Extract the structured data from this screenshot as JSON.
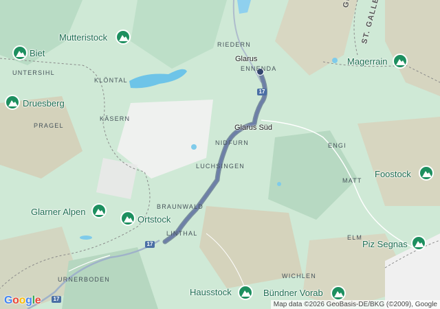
{
  "map": {
    "attribution": "Map data ©2026 GeoBasis-DE/BKG (©2009), Google",
    "logo": {
      "g": "G",
      "o1": "o",
      "o2": "o",
      "g2": "g",
      "l": "l",
      "e": "e"
    },
    "colors": {
      "land": "#cfe9d6",
      "terrain": "#b8dcc4",
      "rock": "#d9cdb8",
      "water": "#6ec4e8",
      "route": "#4b5f88",
      "road": "#9fb2c9",
      "poi": "#1d8f5f"
    }
  },
  "labels": {
    "canton_glarus": "GLARUS",
    "canton_stgallen": "ST. GALLEN",
    "riedern": "RIEDERN",
    "glarus": "Glarus",
    "ennenda": "ENNENDA",
    "untersihl": "UNTERSIHL",
    "klontal": "KLÖNTAL",
    "pragel": "PRAGEL",
    "kasern": "KÄSERN",
    "glarus_sud": "Glarus Süd",
    "nidfurn": "NIDFURN",
    "engi": "ENGI",
    "luchsingen": "LUCHSINGEN",
    "matt": "MATT",
    "braunwald": "BRAUNWALD",
    "linthal": "LINTHAL",
    "elm": "ELM",
    "urnerboden": "URNERBODEN",
    "wichlen": "WICHLEN"
  },
  "peaks": {
    "mutterstock": "Mutteristock",
    "biet": "Biet",
    "druesberg": "Druesberg",
    "magerrain": "Magerrain",
    "foostock": "Foostock",
    "glarner_alpen": "Glarner Alpen",
    "ortstock": "Ortstock",
    "piz_segnas": "Piz Segnas",
    "hausstock": "Hausstock",
    "bundner_vorab": "Bündner Vorab"
  },
  "shields": {
    "road17_top": "17",
    "road17_mid": "17",
    "road17_bottom": "17"
  }
}
